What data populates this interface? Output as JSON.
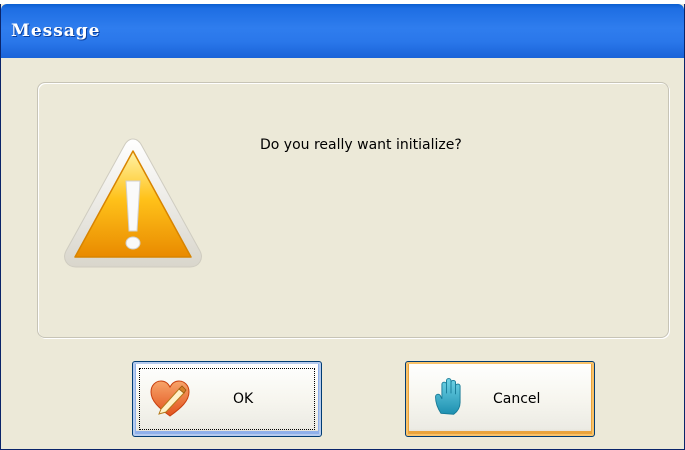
{
  "window": {
    "title": "Message",
    "titlebar_color": "#2f7dee",
    "background_color": "#ece9d8"
  },
  "dialog": {
    "icon": "warning-icon",
    "message": "Do you really want initialize?"
  },
  "buttons": {
    "ok": {
      "label": "OK",
      "icon": "heart-pencil-icon"
    },
    "cancel": {
      "label": "Cancel",
      "icon": "hand-stop-icon"
    }
  }
}
